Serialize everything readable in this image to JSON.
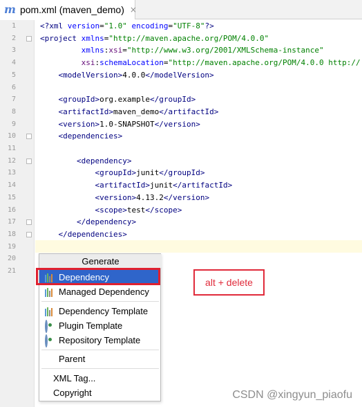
{
  "tab": {
    "icon": "maven-m-icon",
    "icon_glyph": "m",
    "label": "pom.xml (maven_demo)",
    "close_glyph": "×"
  },
  "gutter": {
    "line_numbers": [
      "1",
      "2",
      "3",
      "4",
      "5",
      "6",
      "7",
      "8",
      "9",
      "10",
      "11",
      "12",
      "13",
      "14",
      "15",
      "16",
      "17",
      "18",
      "19",
      "20",
      "21"
    ]
  },
  "code_lines": [
    [
      {
        "c": "tg",
        "t": "<?xml "
      },
      {
        "c": "at",
        "t": "version"
      },
      {
        "c": "tx",
        "t": "="
      },
      {
        "c": "st",
        "t": "\"1.0\""
      },
      {
        "c": "at",
        "t": " encoding"
      },
      {
        "c": "tx",
        "t": "="
      },
      {
        "c": "st",
        "t": "\"UTF-8\""
      },
      {
        "c": "tg",
        "t": "?>"
      }
    ],
    [
      {
        "c": "tg",
        "t": "<project "
      },
      {
        "c": "at",
        "t": "xmlns"
      },
      {
        "c": "tx",
        "t": "="
      },
      {
        "c": "st",
        "t": "\"http://maven.apache.org/POM/4.0.0\""
      }
    ],
    [
      {
        "c": "tx",
        "t": "         "
      },
      {
        "c": "at",
        "t": "xmlns"
      },
      {
        "c": "tx",
        "t": ":"
      },
      {
        "c": "nsAttr",
        "t": "xsi"
      },
      {
        "c": "tx",
        "t": "="
      },
      {
        "c": "st",
        "t": "\"http://www.w3.org/2001/XMLSchema-instance\""
      }
    ],
    [
      {
        "c": "tx",
        "t": "         "
      },
      {
        "c": "nsAttr",
        "t": "xsi"
      },
      {
        "c": "tx",
        "t": ":"
      },
      {
        "c": "at",
        "t": "schemaLocation"
      },
      {
        "c": "tx",
        "t": "="
      },
      {
        "c": "st",
        "t": "\"http://maven.apache.org/POM/4.0.0 http://"
      }
    ],
    [
      {
        "c": "tx",
        "t": "    "
      },
      {
        "c": "tg",
        "t": "<modelVersion>"
      },
      {
        "c": "tx",
        "t": "4.0.0"
      },
      {
        "c": "tg",
        "t": "</modelVersion>"
      }
    ],
    [],
    [
      {
        "c": "tx",
        "t": "    "
      },
      {
        "c": "tg",
        "t": "<groupId>"
      },
      {
        "c": "tx",
        "t": "org.example"
      },
      {
        "c": "tg",
        "t": "</groupId>"
      }
    ],
    [
      {
        "c": "tx",
        "t": "    "
      },
      {
        "c": "tg",
        "t": "<artifactId>"
      },
      {
        "c": "tx",
        "t": "maven_demo"
      },
      {
        "c": "tg",
        "t": "</artifactId>"
      }
    ],
    [
      {
        "c": "tx",
        "t": "    "
      },
      {
        "c": "tg",
        "t": "<version>"
      },
      {
        "c": "tx",
        "t": "1.0-SNAPSHOT"
      },
      {
        "c": "tg",
        "t": "</version>"
      }
    ],
    [
      {
        "c": "tx",
        "t": "    "
      },
      {
        "c": "tg",
        "t": "<dependencies>"
      }
    ],
    [],
    [
      {
        "c": "tx",
        "t": "        "
      },
      {
        "c": "tg",
        "t": "<dependency>"
      }
    ],
    [
      {
        "c": "tx",
        "t": "            "
      },
      {
        "c": "tg",
        "t": "<groupId>"
      },
      {
        "c": "tx",
        "t": "junit"
      },
      {
        "c": "tg",
        "t": "</groupId>"
      }
    ],
    [
      {
        "c": "tx",
        "t": "            "
      },
      {
        "c": "tg",
        "t": "<artifactId>"
      },
      {
        "c": "tx",
        "t": "junit"
      },
      {
        "c": "tg",
        "t": "</artifactId>"
      }
    ],
    [
      {
        "c": "tx",
        "t": "            "
      },
      {
        "c": "tg",
        "t": "<version>"
      },
      {
        "c": "tx",
        "t": "4.13.2"
      },
      {
        "c": "tg",
        "t": "</version>"
      }
    ],
    [
      {
        "c": "tx",
        "t": "            "
      },
      {
        "c": "tg",
        "t": "<scope>"
      },
      {
        "c": "tx",
        "t": "test"
      },
      {
        "c": "tg",
        "t": "</scope>"
      }
    ],
    [
      {
        "c": "tx",
        "t": "        "
      },
      {
        "c": "tg",
        "t": "</dependency>"
      }
    ],
    [
      {
        "c": "tx",
        "t": "    "
      },
      {
        "c": "tg",
        "t": "</dependencies>"
      }
    ],
    [],
    [],
    []
  ],
  "generate_menu": {
    "title": "Generate",
    "items": [
      {
        "label": "Dependency",
        "icon": "dependency-bars-icon",
        "selected": true
      },
      {
        "label": "Managed Dependency",
        "icon": "dependency-bars-icon",
        "selected": false
      },
      {
        "label": "Dependency Template",
        "icon": "dependency-bars-icon",
        "selected": false
      },
      {
        "label": "Plugin Template",
        "icon": "plugin-icon",
        "selected": false
      },
      {
        "label": "Repository Template",
        "icon": "plugin-icon",
        "selected": false
      },
      {
        "label": "Parent",
        "icon": "parent-pom-icon",
        "selected": false
      },
      {
        "label": "XML Tag...",
        "icon": "",
        "selected": false
      },
      {
        "label": "Copyright",
        "icon": "",
        "selected": false
      }
    ]
  },
  "annotation": {
    "text": "alt + delete",
    "color": "#e02a3a"
  },
  "watermark": "CSDN @xingyun_piaofu",
  "colors": {
    "selection": "#2f65ca",
    "tag": "#000080",
    "attribute": "#0000ff",
    "string": "#008000"
  }
}
